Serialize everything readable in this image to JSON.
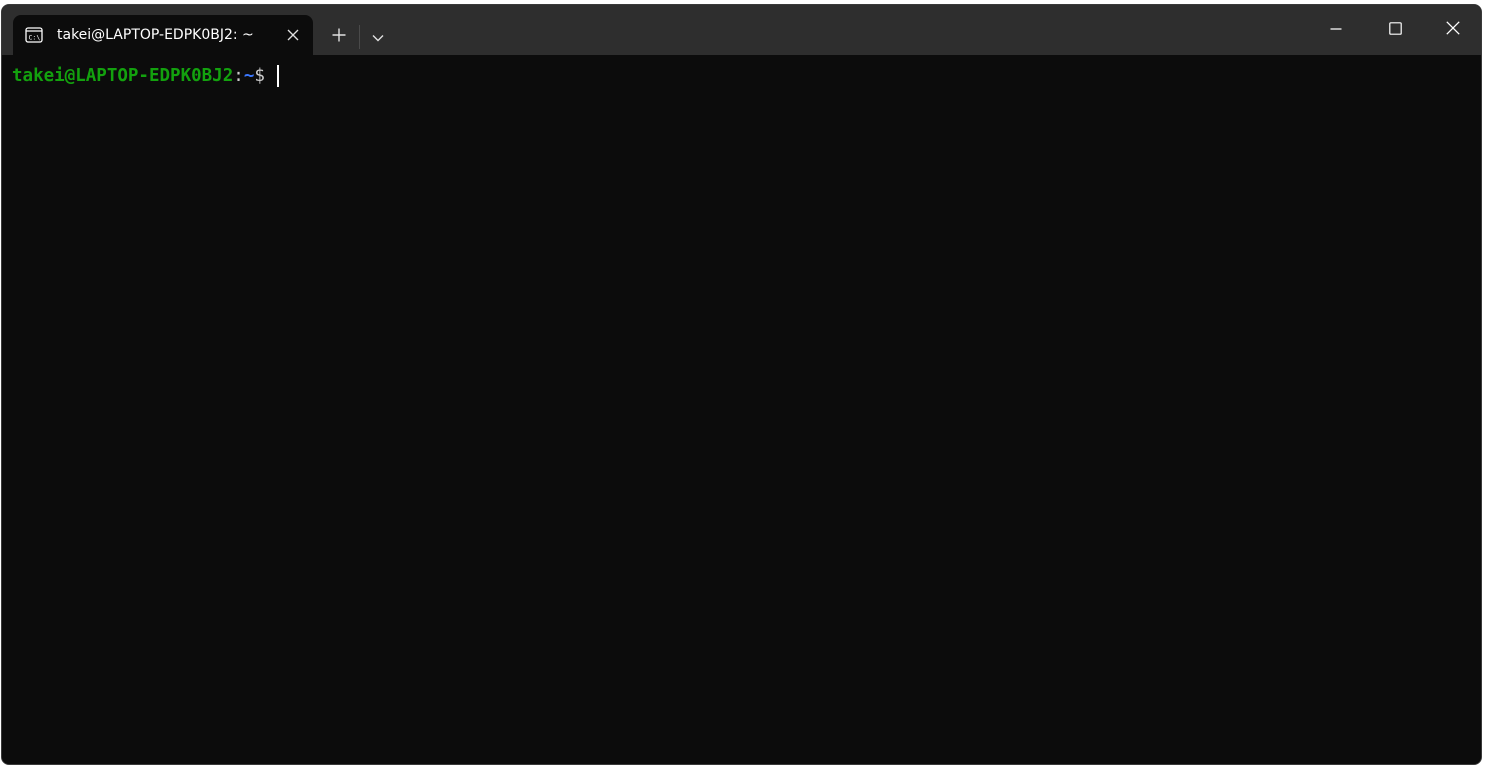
{
  "tab": {
    "title": "takei@LAPTOP-EDPK0BJ2: ~",
    "icon": "terminal-icon"
  },
  "toolbar": {
    "new_tab_icon": "plus-icon",
    "dropdown_icon": "chevron-down-icon"
  },
  "window_controls": {
    "minimize_icon": "minimize-icon",
    "maximize_icon": "maximize-icon",
    "close_icon": "close-icon"
  },
  "terminal": {
    "prompt_user_host": "takei@LAPTOP-EDPK0BJ2",
    "prompt_colon": ":",
    "prompt_path": "~",
    "prompt_symbol": "$ "
  },
  "colors": {
    "titlebar": "#2e2e2e",
    "background": "#0c0c0c",
    "prompt_user": "#13a10e",
    "prompt_path": "#3b78ff",
    "text": "#cccccc"
  }
}
